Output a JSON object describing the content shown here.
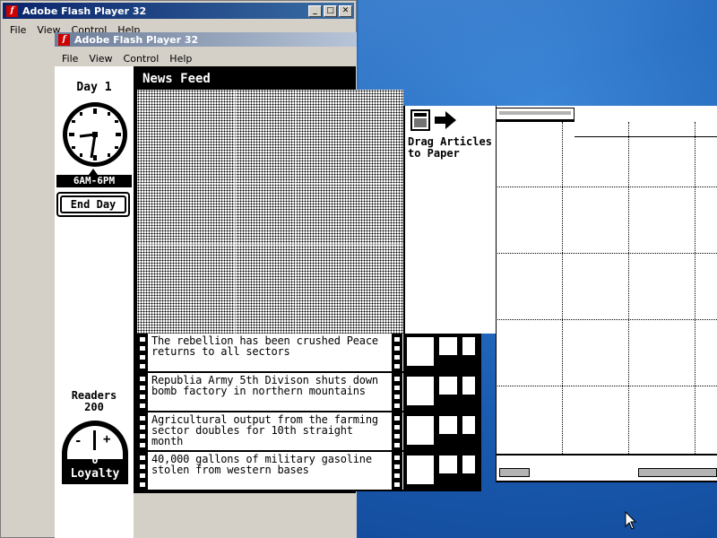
{
  "windows": {
    "back": {
      "title": "Adobe Flash Player 32",
      "menu": [
        "File",
        "View",
        "Control",
        "Help"
      ],
      "controls": [
        "minimize",
        "maximize",
        "close"
      ]
    },
    "front": {
      "title": "Adobe Flash Player 32",
      "menu": [
        "File",
        "View",
        "Control",
        "Help"
      ]
    }
  },
  "game": {
    "day_label": "Day 1",
    "time_range": "6AM-6PM",
    "end_day_button": "End Day",
    "readers_label": "Readers",
    "readers_count": "200",
    "loyalty_label": "Loyalty",
    "loyalty_value": "0",
    "loyalty_minus": "-",
    "loyalty_plus": "+",
    "news_feed_title": "News Feed",
    "drag_hint": "Drag Articles to Paper",
    "articles": [
      {
        "headline": "The rebellion has been crushed Peace returns to all sectors"
      },
      {
        "headline": "Republia Army 5th Divison shuts down bomb factory in northern mountains"
      },
      {
        "headline": "Agricultural output from the farming sector doubles for 10th straight month"
      },
      {
        "headline": "40,000 gallons of military gasoline stolen from western bases"
      }
    ]
  },
  "icons": {
    "flash": "flash-player-icon",
    "clock": "clock-icon",
    "arrow": "right-arrow-icon",
    "cursor": "mouse-cursor-icon"
  }
}
